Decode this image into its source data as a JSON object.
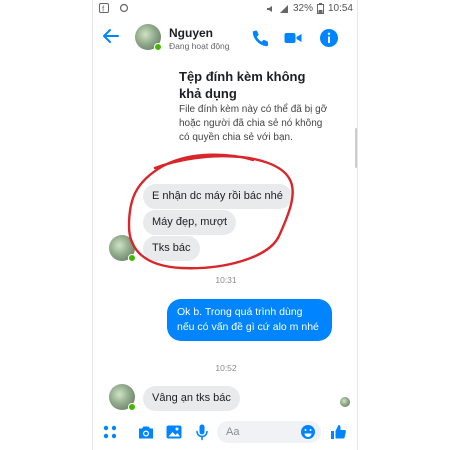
{
  "status_bar": {
    "battery": "32%",
    "time": "10:54"
  },
  "header": {
    "name": "Nguyen",
    "status": "Đang hoạt động"
  },
  "attachment": {
    "title": "Tệp đính kèm không khả dụng",
    "description": "File đính kèm này có thể đã bị gỡ hoặc người đã chia sẻ nó không có quyền chia sẻ với bạn."
  },
  "timestamps": {
    "t1": "10:31",
    "t2": "10:52"
  },
  "messages": [
    {
      "sender": "Nguyen",
      "text": "E nhận dc máy rồi bác nhé"
    },
    {
      "sender": "Nguyen",
      "text": "Máy đẹp, mượt"
    },
    {
      "sender": "Nguyen",
      "text": "Tks bác"
    },
    {
      "sender": "me",
      "text": "Ok b. Trong quá trình dùng nếu có vấn đề gì cứ alo m nhé"
    },
    {
      "sender": "Nguyen",
      "text": "Vâng ạn tks bác"
    }
  ],
  "composer": {
    "placeholder": "Aa"
  },
  "colors": {
    "accent": "#0084ff",
    "incoming_bubble": "#e9eaec",
    "annotation": "#d8262b",
    "online": "#44b700"
  }
}
